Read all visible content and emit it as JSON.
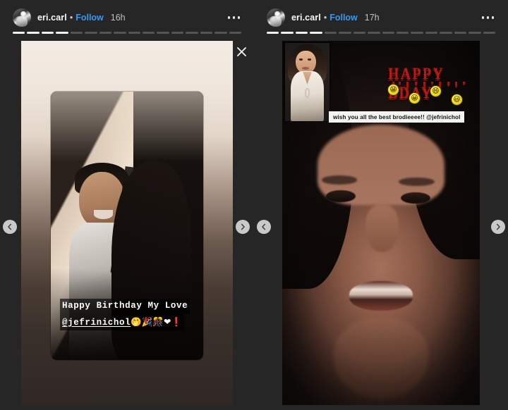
{
  "app": {
    "name": "instagram-stories-viewer",
    "background": "#262626"
  },
  "colors": {
    "background": "#262626",
    "follow_link": "#3897f0",
    "progress_active": "#f2f2f2",
    "progress_inactive": "rgba(255,255,255,0.22)",
    "nav_button": "#c9c9c9",
    "bday_red": "#b81a12",
    "smiley_yellow": "#f7e01f"
  },
  "stories": [
    {
      "id": "story-left",
      "header": {
        "avatar": "user-avatar",
        "username": "eri.carl",
        "separator": "•",
        "follow_label": "Follow",
        "timestamp": "16h",
        "more_icon": "more-options-icon"
      },
      "progress": {
        "total": 16,
        "active": 4
      },
      "caption": {
        "line1": "Happy Birthday My Love",
        "line2_handle": "@jefrinichol",
        "line2_emoji": "🤭🎉🎊❤❗"
      },
      "close_label": "×"
    },
    {
      "id": "story-right",
      "header": {
        "avatar": "user-avatar",
        "username": "eri.carl",
        "separator": "•",
        "follow_label": "Follow",
        "timestamp": "17h",
        "more_icon": "more-options-icon"
      },
      "progress": {
        "total": 16,
        "active": 4
      },
      "sticker_title": "HAPPY BDAY",
      "smileys": [
        "😁",
        "😀",
        "😄",
        "😃"
      ],
      "caption": "wish you all the best brodieeee!! @jefrinichol",
      "close_label": "×"
    }
  ],
  "navigation": [
    {
      "name": "prev-story-far-left",
      "direction": "prev",
      "glyph": "‹"
    },
    {
      "name": "next-story-left-panel",
      "direction": "next",
      "glyph": "›"
    },
    {
      "name": "prev-story-right-panel",
      "direction": "prev",
      "glyph": "‹"
    },
    {
      "name": "next-story-far-right",
      "direction": "next",
      "glyph": "›"
    }
  ]
}
